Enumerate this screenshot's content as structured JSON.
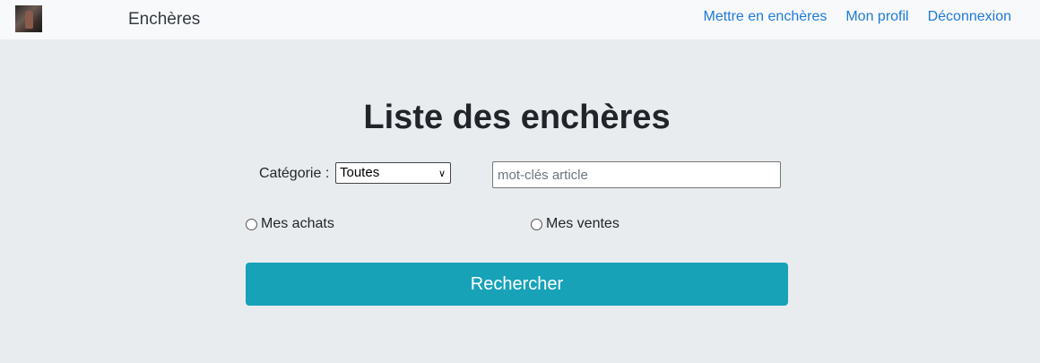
{
  "header": {
    "brand": "Enchères",
    "nav": {
      "sell": "Mettre en enchères",
      "profile": "Mon profil",
      "logout": "Déconnexion"
    }
  },
  "main": {
    "title": "Liste des enchères",
    "category": {
      "label": "Catégorie :",
      "selected": "Toutes"
    },
    "search": {
      "placeholder": "mot-clés article",
      "value": ""
    },
    "radios": {
      "purchases": "Mes achats",
      "sales": "Mes ventes"
    },
    "submit_label": "Rechercher"
  },
  "colors": {
    "accent": "#17a2b8",
    "link": "#1e7bd6",
    "background": "#e9ecef",
    "navbar": "#f8f9fa"
  },
  "icons": {
    "logo": "auction-logo-icon",
    "select_arrow": "chevron-down-icon"
  }
}
